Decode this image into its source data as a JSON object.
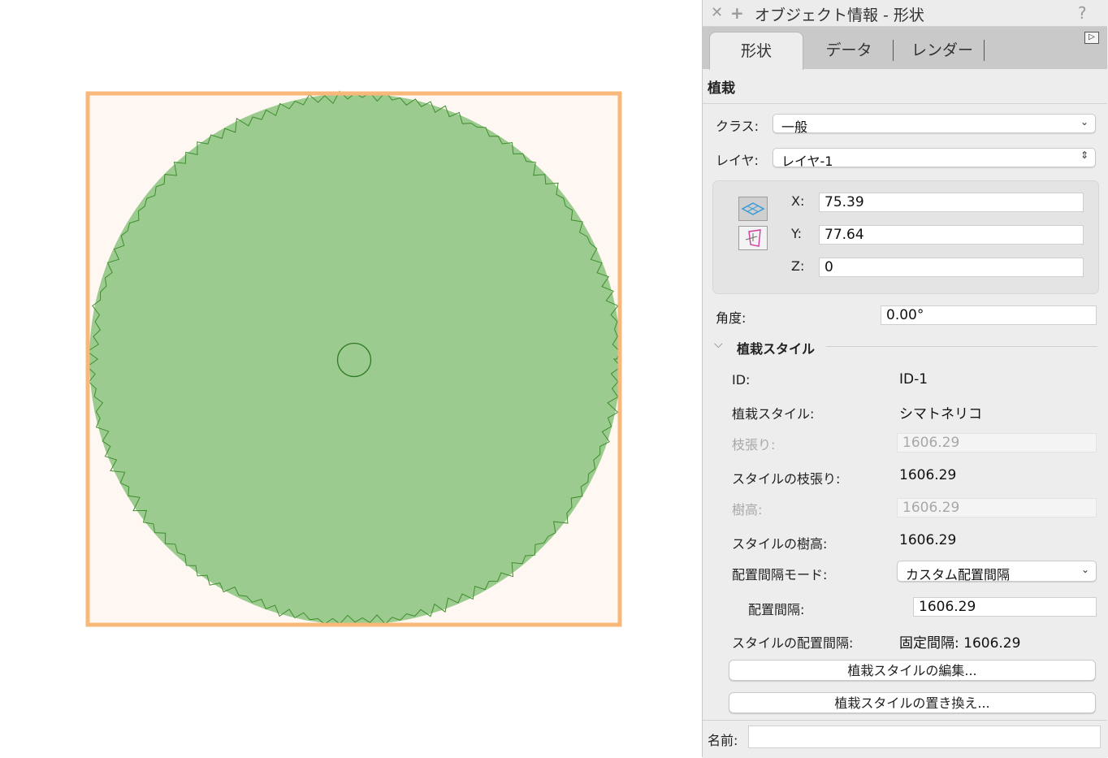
{
  "palette": {
    "title": "オブジェクト情報 - 形状",
    "tabs": [
      {
        "label": "形状",
        "active": true
      },
      {
        "label": "データ",
        "active": false
      },
      {
        "label": "レンダー",
        "active": false
      }
    ],
    "section_title": "植栽",
    "class": {
      "label": "クラス:",
      "value": "一般"
    },
    "layer": {
      "label": "レイヤ:",
      "value": "レイヤ-1"
    },
    "coords": {
      "x_label": "X:",
      "x_value": "75.39",
      "y_label": "Y:",
      "y_value": "77.64",
      "z_label": "Z:",
      "z_value": "0"
    },
    "angle": {
      "label": "角度:",
      "value": "0.00°"
    },
    "style_group": {
      "title": "植栽スタイル",
      "id_label": "ID:",
      "id_value": "ID-1",
      "style_label": "植栽スタイル:",
      "style_value": "シマトネリコ",
      "spread_label": "枝張り:",
      "spread_value": "1606.29",
      "style_spread_label": "スタイルの枝張り:",
      "style_spread_value": "1606.29",
      "height_label": "樹高:",
      "height_value": "1606.29",
      "style_height_label": "スタイルの樹高:",
      "style_height_value": "1606.29",
      "spacing_mode_label": "配置間隔モード:",
      "spacing_mode_value": "カスタム配置間隔",
      "spacing_label": "配置間隔:",
      "spacing_value": "1606.29",
      "style_spacing_label": "スタイルの配置間隔:",
      "style_spacing_value": "固定間隔: 1606.29",
      "edit_button": "植栽スタイルの編集...",
      "replace_button": "植栽スタイルの置き換え..."
    },
    "name": {
      "label": "名前:",
      "value": ""
    }
  },
  "colors": {
    "plant_fill": "#9bcb8f",
    "plant_outline": "#3f8e2e",
    "selection": "#f7b87a",
    "selection_bg": "#fff7f2",
    "palette_bg": "#ededed"
  }
}
